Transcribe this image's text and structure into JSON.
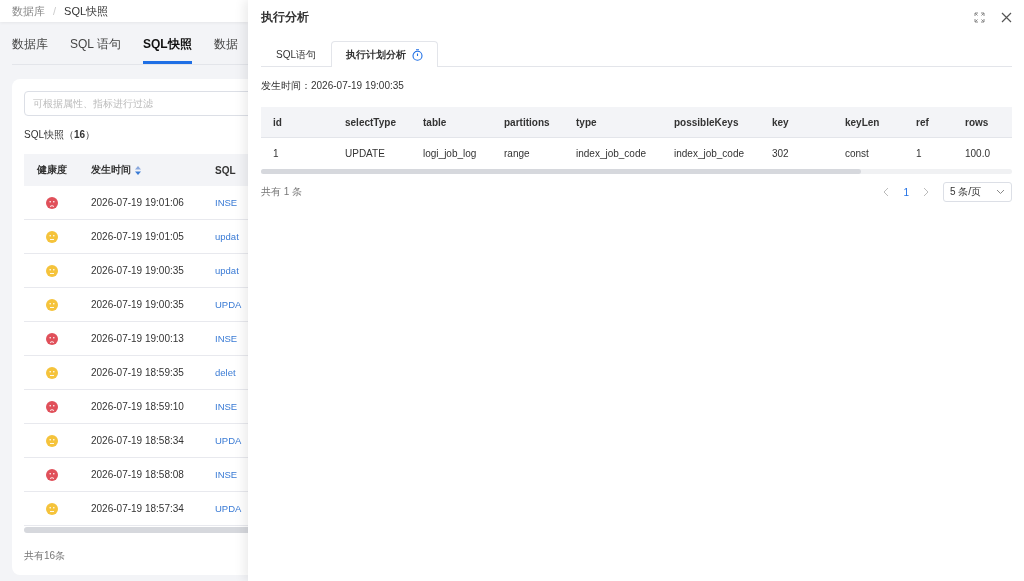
{
  "breadcrumb": [
    "数据库",
    "SQL快照"
  ],
  "breadcrumb_separator": "/",
  "tabs": [
    {
      "label": "数据库",
      "selected": false
    },
    {
      "label": "SQL 语句",
      "selected": false
    },
    {
      "label": "SQL快照",
      "selected": true
    },
    {
      "label": "数据",
      "selected": false
    }
  ],
  "filter": {
    "placeholder": "可根据属性、指标进行过滤"
  },
  "snapshot_title": "SQL快照（**16**）",
  "table": {
    "columns": [
      "健康度",
      "发生时间",
      "SQL"
    ],
    "rows": [
      {
        "kind": "sad",
        "color": "#e0505a",
        "time": "2026-07-19 19:01:06",
        "sql": "INSE"
      },
      {
        "kind": "neutral",
        "color": "#f5c33b",
        "time": "2026-07-19 19:01:05",
        "sql": "updat"
      },
      {
        "kind": "neutral",
        "color": "#f5c33b",
        "time": "2026-07-19 19:00:35",
        "sql": "updat"
      },
      {
        "kind": "neutral",
        "color": "#f5c33b",
        "time": "2026-07-19 19:00:35",
        "sql": "UPDA"
      },
      {
        "kind": "sad",
        "color": "#e0505a",
        "time": "2026-07-19 19:00:13",
        "sql": "INSE"
      },
      {
        "kind": "neutral",
        "color": "#f5c33b",
        "time": "2026-07-19 18:59:35",
        "sql": "delet"
      },
      {
        "kind": "sad",
        "color": "#e0505a",
        "time": "2026-07-19 18:59:10",
        "sql": "INSE"
      },
      {
        "kind": "neutral",
        "color": "#f5c33b",
        "time": "2026-07-19 18:58:34",
        "sql": "UPDA"
      },
      {
        "kind": "sad",
        "color": "#e0505a",
        "time": "2026-07-19 18:58:08",
        "sql": "INSE"
      },
      {
        "kind": "neutral",
        "color": "#f5c33b",
        "time": "2026-07-19 18:57:34",
        "sql": "UPDA"
      }
    ]
  },
  "total": "共有16条",
  "drawer": {
    "title": "执行分析",
    "tabs": [
      {
        "label": "SQL语句",
        "selected": false
      },
      {
        "label": "执行计划分析",
        "selected": true
      }
    ],
    "time_label": "发生时间：",
    "time": "2026-07-19 19:00:35",
    "plan": {
      "columns": [
        "id",
        "selectType",
        "table",
        "partitions",
        "type",
        "possibleKeys",
        "key",
        "keyLen",
        "ref",
        "rows"
      ],
      "rows": [
        [
          "1",
          "UPDATE",
          "logi_job_log",
          "range",
          "index_job_code",
          "index_job_code",
          "302",
          "const",
          "1",
          "100.0"
        ]
      ]
    },
    "total": "共有 1 条",
    "page": "1",
    "page_size": "5 条/页"
  }
}
